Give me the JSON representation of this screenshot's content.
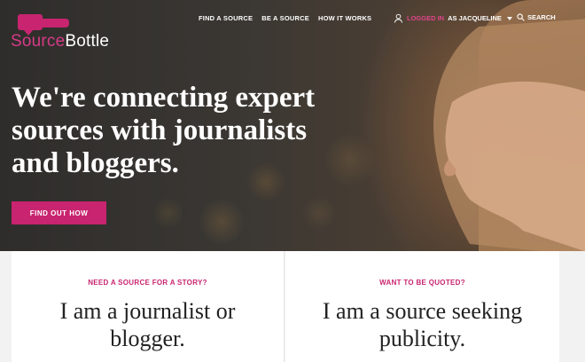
{
  "logo": {
    "part1": "Source",
    "part2": "Bottle"
  },
  "nav": {
    "items": [
      "FIND A SOURCE",
      "BE A SOURCE",
      "HOW IT WORKS"
    ]
  },
  "user": {
    "logged_label": "LOGGED IN",
    "name_label": "AS JACQUELINE"
  },
  "search": {
    "label": "SEARCH"
  },
  "hero": {
    "headline_line1": "We're connecting expert",
    "headline_line2": "sources with journalists",
    "headline_line3": "and bloggers.",
    "cta_label": "FIND OUT HOW"
  },
  "cards": [
    {
      "eyebrow": "NEED A SOURCE FOR A STORY?",
      "title_line1": "I am a journalist or",
      "title_line2": "blogger."
    },
    {
      "eyebrow": "WANT TO BE QUOTED?",
      "title_line1": "I am a source seeking",
      "title_line2": "publicity."
    }
  ],
  "colors": {
    "accent": "#c8246f",
    "white": "#ffffff",
    "text_dark": "#222222"
  }
}
